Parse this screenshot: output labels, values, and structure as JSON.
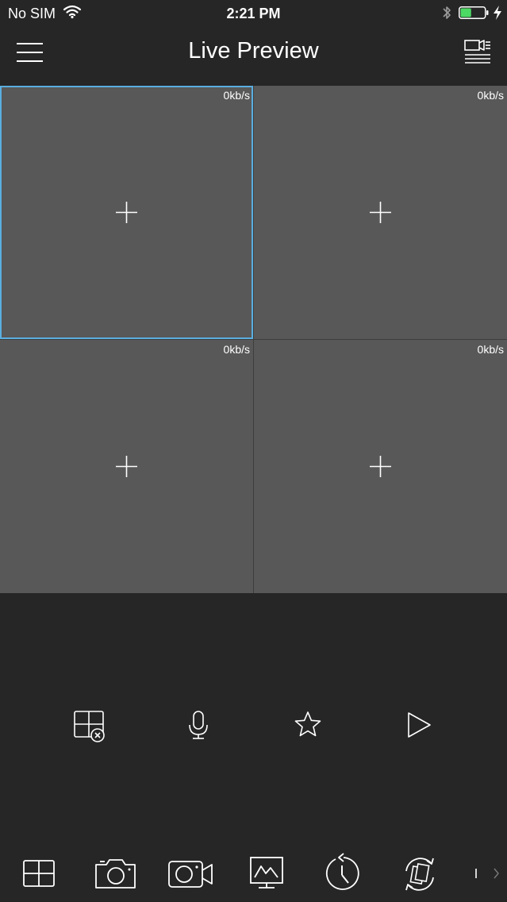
{
  "status_bar": {
    "carrier": "No SIM",
    "time": "2:21 PM",
    "battery_level": 0.45,
    "battery_color": "#4cd964"
  },
  "nav": {
    "title": "Live Preview",
    "menu_icon": "hamburger-menu-icon",
    "right_icon": "device-list-icon"
  },
  "colors": {
    "background": "#262626",
    "window": "#585858",
    "selected_border": "#5aaee0"
  },
  "video_windows": [
    {
      "bitrate": "0kb/s",
      "selected": true
    },
    {
      "bitrate": "0kb/s",
      "selected": false
    },
    {
      "bitrate": "0kb/s",
      "selected": false
    },
    {
      "bitrate": "0kb/s",
      "selected": false
    }
  ],
  "controls": [
    {
      "icon": "close-all-windows-icon"
    },
    {
      "icon": "microphone-icon"
    },
    {
      "icon": "star-icon"
    },
    {
      "icon": "play-icon"
    }
  ],
  "toolbar": [
    {
      "icon": "split-screen-icon"
    },
    {
      "icon": "camera-icon"
    },
    {
      "icon": "video-record-icon"
    },
    {
      "icon": "video-wall-icon"
    },
    {
      "icon": "playback-history-icon"
    },
    {
      "icon": "switch-stream-icon"
    },
    {
      "icon": "more-chevron-icon"
    }
  ]
}
